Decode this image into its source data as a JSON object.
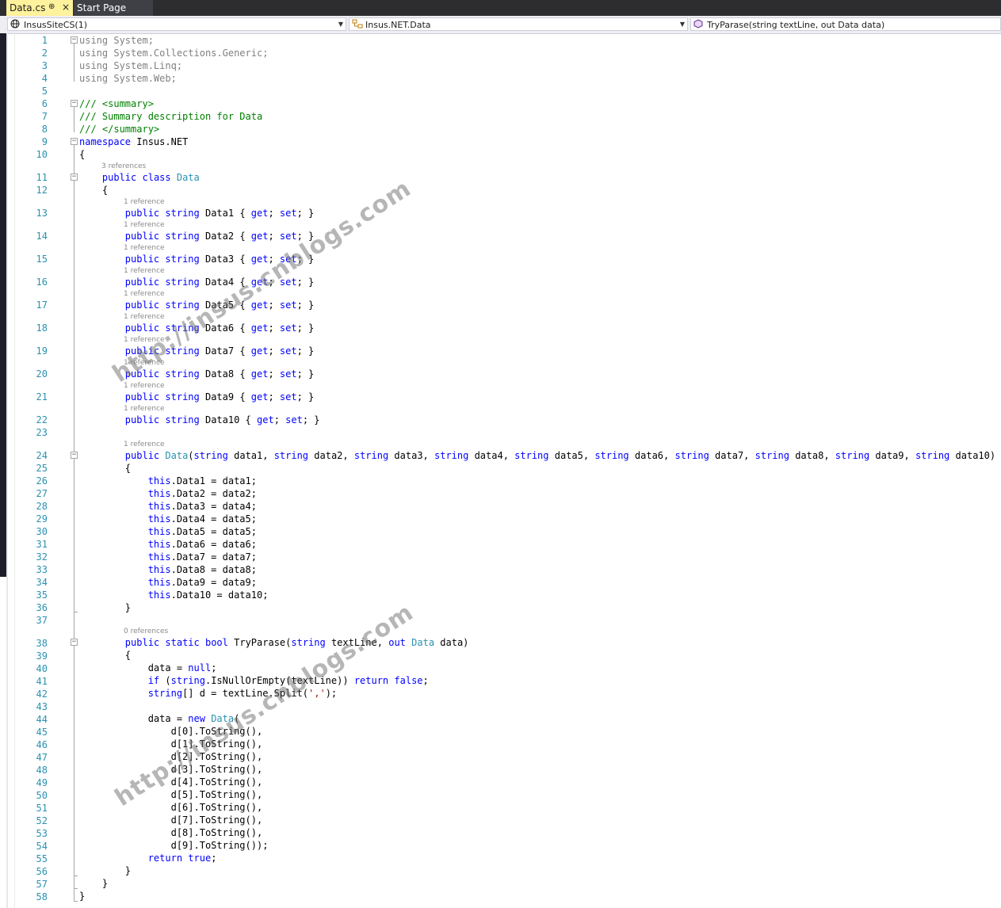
{
  "tabs": [
    {
      "label": "Data.cs",
      "pin": "⊕",
      "close": "×"
    },
    {
      "label": "Start Page"
    }
  ],
  "nav": {
    "project": "InsusSiteCS(1)",
    "type": "Insus.NET.Data",
    "member": "TryParase(string textLine, out Data data)"
  },
  "watermark": "http://insus.cnblogs.com",
  "lens": {
    "refs3": "3 references",
    "ref1": "1 reference",
    "refs0": "0 references"
  },
  "lines": {
    "l1": "using System;",
    "l2": "using System.Collections.Generic;",
    "l3": "using System.Linq;",
    "l4": "using System.Web;",
    "l6": "/// <summary>",
    "l7": "/// Summary description for Data",
    "l8": "/// </summary>",
    "l9": "namespace Insus.NET",
    "l10": "{",
    "l11": "    public class Data",
    "l12": "    {",
    "l13": "        public string Data1 { get; set; }",
    "l14": "        public string Data2 { get; set; }",
    "l15": "        public string Data3 { get; set; }",
    "l16": "        public string Data4 { get; set; }",
    "l17": "        public string Data5 { get; set; }",
    "l18": "        public string Data6 { get; set; }",
    "l19": "        public string Data7 { get; set; }",
    "l20": "        public string Data8 { get; set; }",
    "l21": "        public string Data9 { get; set; }",
    "l22": "        public string Data10 { get; set; }",
    "l24": "        public Data(string data1, string data2, string data3, string data4, string data5, string data6, string data7, string data8, string data9, string data10)",
    "l25": "        {",
    "l26": "            this.Data1 = data1;",
    "l27": "            this.Data2 = data2;",
    "l28": "            this.Data3 = data4;",
    "l29": "            this.Data4 = data5;",
    "l30": "            this.Data5 = data5;",
    "l31": "            this.Data6 = data6;",
    "l32": "            this.Data7 = data7;",
    "l33": "            this.Data8 = data8;",
    "l34": "            this.Data9 = data9;",
    "l35": "            this.Data10 = data10;",
    "l36": "        }",
    "l38": "        public static bool TryParase(string textLine, out Data data)",
    "l39": "        {",
    "l40": "            data = null;",
    "l41": "            if (string.IsNullOrEmpty(textLine)) return false;",
    "l42": "            string[] d = textLine.Split(',');",
    "l44": "            data = new Data(",
    "l45": "                d[0].ToString(),",
    "l46": "                d[1].ToString(),",
    "l47": "                d[2].ToString(),",
    "l48": "                d[3].ToString(),",
    "l49": "                d[4].ToString(),",
    "l50": "                d[5].ToString(),",
    "l51": "                d[6].ToString(),",
    "l52": "                d[7].ToString(),",
    "l53": "                d[8].ToString(),",
    "l54": "                d[9].ToString());",
    "l55": "            return true;",
    "l56": "        }",
    "l57": "    }",
    "l58": "}"
  },
  "line_numbers": [
    "1",
    "2",
    "3",
    "4",
    "5",
    "6",
    "7",
    "8",
    "9",
    "10",
    "11",
    "12",
    "13",
    "14",
    "15",
    "16",
    "17",
    "18",
    "19",
    "20",
    "21",
    "22",
    "23",
    "24",
    "25",
    "26",
    "27",
    "28",
    "29",
    "30",
    "31",
    "32",
    "33",
    "34",
    "35",
    "36",
    "37",
    "38",
    "39",
    "40",
    "41",
    "42",
    "43",
    "44",
    "45",
    "46",
    "47",
    "48",
    "49",
    "50",
    "51",
    "52",
    "53",
    "54",
    "55",
    "56",
    "57",
    "58"
  ],
  "colors": {
    "keyword": "#0000ff",
    "type": "#2b91af",
    "comment": "#008000",
    "doc_tag": "#808080",
    "string": "#a31515",
    "active_tab": "#fff29d",
    "tabbar": "#2d2d30"
  },
  "icons": {
    "project": "globe-icon",
    "type": "class-icon",
    "member": "method-icon"
  }
}
